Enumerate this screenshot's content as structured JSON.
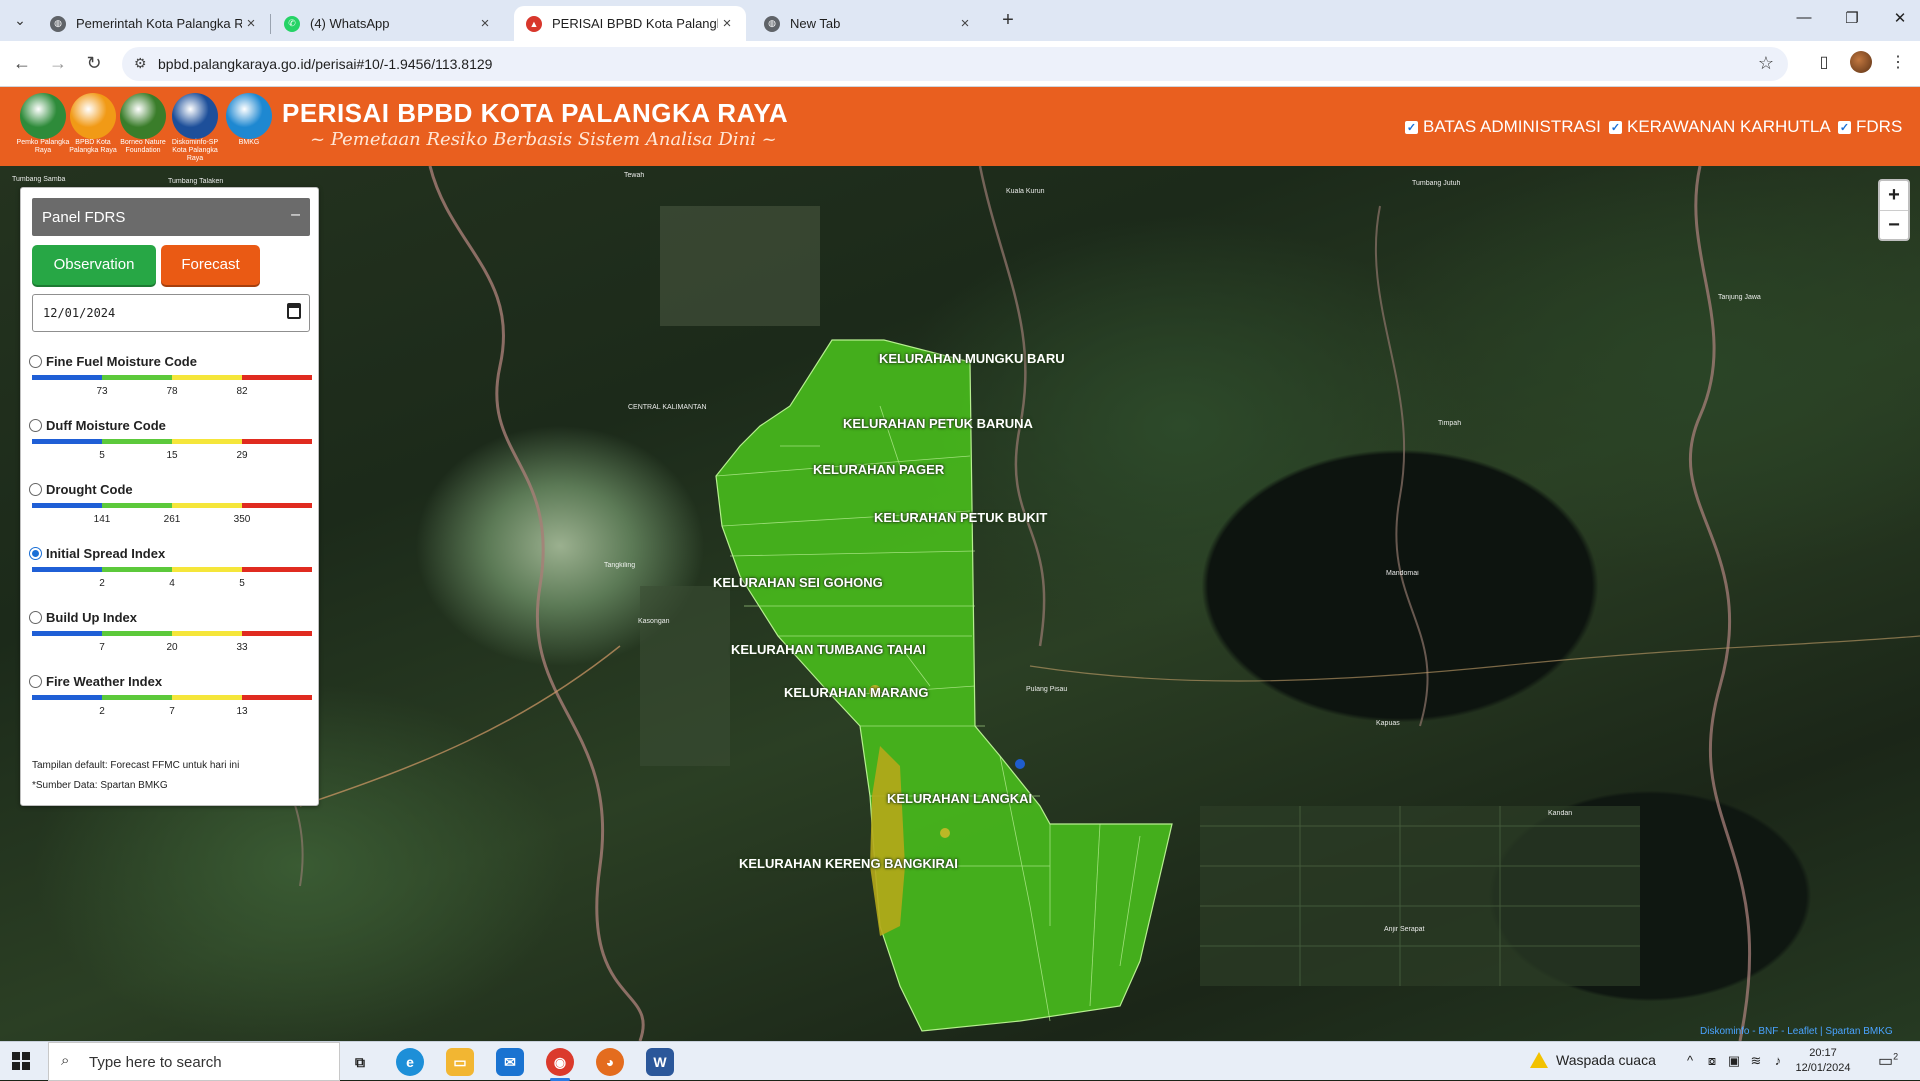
{
  "browser": {
    "tabs": [
      {
        "title": "Pemerintah Kota Palangka Raya",
        "favicon": "globe-icon",
        "active": false
      },
      {
        "title": "(4) WhatsApp",
        "favicon": "whatsapp-icon",
        "active": false
      },
      {
        "title": "PERISAI BPBD Kota Palangka Ra",
        "favicon": "perisai-icon",
        "active": true
      },
      {
        "title": "New Tab",
        "favicon": "globe-icon",
        "active": false
      }
    ],
    "url": "bpbd.palangkaraya.go.id/perisai#10/-1.9456/113.8129"
  },
  "header": {
    "title": "PERISAI BPBD KOTA PALANGKA RAYA",
    "subtitle": "~ Pemetaan Resiko Berbasis Sistem Analisa Dini ~",
    "logos": [
      {
        "caption": "Pemko Palangka Raya",
        "color": "#2e8b3a"
      },
      {
        "caption": "BPBD Kota Palangka Raya",
        "color": "#f19a16"
      },
      {
        "caption": "Borneo Nature Foundation",
        "color": "#3a7d2a"
      },
      {
        "caption": "Diskominfo-SP Kota Palangka Raya",
        "color": "#1d4f9a"
      },
      {
        "caption": "BMKG",
        "color": "#1e88d1"
      }
    ],
    "layers": [
      {
        "label": "BATAS ADMINISTRASI",
        "checked": true
      },
      {
        "label": "KERAWANAN KARHUTLA",
        "checked": true
      },
      {
        "label": "FDRS",
        "checked": true
      }
    ]
  },
  "panel": {
    "title": "Panel FDRS",
    "collapse": "–",
    "observation_label": "Observation",
    "forecast_label": "Forecast",
    "date_value": "12/01/2024",
    "indices": [
      {
        "name": "Fine Fuel Moisture Code",
        "ticks": [
          "73",
          "78",
          "82"
        ],
        "selected": false
      },
      {
        "name": "Duff Moisture Code",
        "ticks": [
          "5",
          "15",
          "29"
        ],
        "selected": false
      },
      {
        "name": "Drought Code",
        "ticks": [
          "141",
          "261",
          "350"
        ],
        "selected": false
      },
      {
        "name": "Initial Spread Index",
        "ticks": [
          "2",
          "4",
          "5"
        ],
        "selected": true
      },
      {
        "name": "Build Up Index",
        "ticks": [
          "7",
          "20",
          "33"
        ],
        "selected": false
      },
      {
        "name": "Fire Weather Index",
        "ticks": [
          "2",
          "7",
          "13"
        ],
        "selected": false
      }
    ],
    "scale_colors": [
      "#1f5fd6",
      "#5cc93b",
      "#f5e63a",
      "#e02b20"
    ],
    "note_default": "Tampilan default: Forecast FFMC untuk hari ini",
    "note_source": "*Sumber Data: Spartan BMKG"
  },
  "map": {
    "kelurahan": [
      "KELURAHAN MUNGKU BARU",
      "KELURAHAN PETUK BARUNA",
      "KELURAHAN PAGER",
      "KELURAHAN PETUK BUKIT",
      "KELURAHAN SEI GOHONG",
      "KELURAHAN TUMBANG TAHAI",
      "KELURAHAN MARANG",
      "KELURAHAN LANGKAI",
      "KELURAHAN KERENG BANGKIRAI"
    ],
    "places": [
      "Tumbang Samba",
      "Tumbang Talaken",
      "Tewah",
      "Kuala Kurun",
      "Tumbang Jutuh",
      "CENTRAL KALIMANTAN",
      "Tangkiling",
      "Kasongan",
      "Pulang Pisau",
      "Tanjung Jawa",
      "Timpah",
      "Mandomai",
      "Kapuas",
      "Anjir Serapat",
      "Kandan"
    ],
    "zoom_in": "+",
    "zoom_out": "−",
    "attribution": "Diskominfo - BNF - Leaflet | Spartan BMKG",
    "polygon_color": "#47b51c",
    "highlight_color": "#b5a81a"
  },
  "taskbar": {
    "search_placeholder": "Type here to search",
    "weather": "Waspada cuaca",
    "time": "20:17",
    "date": "12/01/2024",
    "notification_count": "2"
  }
}
